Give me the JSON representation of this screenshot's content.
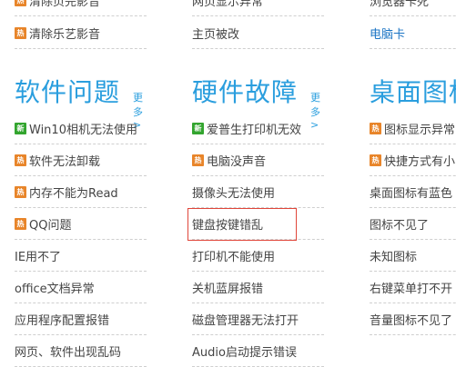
{
  "colors": {
    "accent": "#2a9ede",
    "link": "#1a74c4",
    "hot_badge": "#e8852a",
    "new_badge": "#33a52f",
    "highlight": "#e0463a"
  },
  "top": {
    "col1": [
      {
        "badge": "hot",
        "text": "清除页完影音"
      },
      {
        "badge": "hot",
        "text": "清除乐艺影音"
      }
    ],
    "col2": [
      {
        "text": "网页显示异常"
      },
      {
        "text": "主页被改"
      }
    ],
    "col3": [
      {
        "text": "浏览器卡死"
      },
      {
        "text": "电脑卡",
        "link": true
      }
    ]
  },
  "sections": [
    {
      "title": "软件问题",
      "more": "更多>",
      "items": [
        {
          "badge": "new",
          "text": "Win10相机无法使用"
        },
        {
          "badge": "hot",
          "text": "软件无法卸载"
        },
        {
          "badge": "hot",
          "text": "内存不能为Read"
        },
        {
          "badge": "hot",
          "text": "QQ问题"
        },
        {
          "text": "IE用不了"
        },
        {
          "text": "office文档异常"
        },
        {
          "text": "应用程序配置报错"
        },
        {
          "text": "网页、软件出现乱码"
        }
      ]
    },
    {
      "title": "硬件故障",
      "more": "更多>",
      "items": [
        {
          "badge": "new",
          "text": "爱普生打印机无效"
        },
        {
          "badge": "hot",
          "text": "电脑没声音"
        },
        {
          "text": "摄像头无法使用"
        },
        {
          "text": "键盘按键错乱"
        },
        {
          "text": "打印机不能使用"
        },
        {
          "text": "关机蓝屏报错"
        },
        {
          "text": "磁盘管理器无法打开"
        },
        {
          "text": "Audio启动提示错误"
        }
      ]
    },
    {
      "title": "桌面图标",
      "more": "",
      "items": [
        {
          "badge": "hot",
          "text": "图标显示异常"
        },
        {
          "badge": "hot",
          "text": "快捷方式有小"
        },
        {
          "text": "桌面图标有蓝色"
        },
        {
          "text": "图标不见了"
        },
        {
          "text": "未知图标"
        },
        {
          "text": "右键菜单打不开"
        },
        {
          "text": "音量图标不见了"
        }
      ]
    }
  ],
  "badge_labels": {
    "hot": "热",
    "new": "新"
  }
}
